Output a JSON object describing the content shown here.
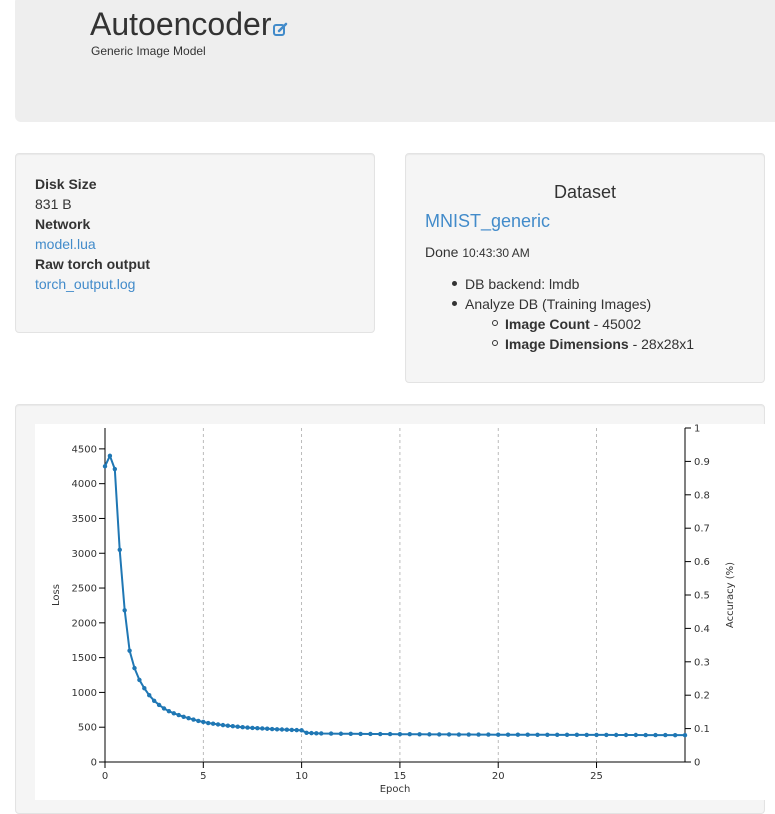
{
  "header": {
    "title": "Autoencoder",
    "subtitle": "Generic Image Model",
    "edit_icon": "edit-icon"
  },
  "info": {
    "disk_size_label": "Disk Size",
    "disk_size_value": "831 B",
    "network_label": "Network",
    "network_link": "model.lua",
    "raw_output_label": "Raw torch output",
    "raw_output_link": "torch_output.log"
  },
  "dataset": {
    "heading": "Dataset",
    "name": "MNIST_generic",
    "status": "Done",
    "status_time": "10:43:30 AM",
    "backend_text": "DB backend: lmdb",
    "analyze_text": "Analyze DB (Training Images)",
    "image_count_label": "Image Count",
    "image_count_value": " - 45002",
    "image_dims_label": "Image Dimensions",
    "image_dims_value": " - 28x28x1"
  },
  "colors": {
    "accent": "#428bca",
    "series": "#1f77b4"
  },
  "chart_data": {
    "type": "line",
    "xlabel": "Epoch",
    "ylabel": "Loss",
    "y2label": "Accuracy (%)",
    "xlim": [
      0,
      29.5
    ],
    "ylim": [
      0,
      4800
    ],
    "y2lim": [
      0,
      1
    ],
    "xticks": [
      0,
      5,
      10,
      15,
      20,
      25
    ],
    "yticks": [
      0,
      500,
      1000,
      1500,
      2000,
      2500,
      3000,
      3500,
      4000,
      4500
    ],
    "y2ticks": [
      0,
      0.1,
      0.2,
      0.3,
      0.4,
      0.5,
      0.6,
      0.7,
      0.8,
      0.9,
      1
    ],
    "grid_x": true,
    "series": [
      {
        "name": "",
        "x": [
          0,
          0.25,
          0.5,
          0.75,
          1,
          1.25,
          1.5,
          1.75,
          2,
          2.25,
          2.5,
          2.75,
          3,
          3.25,
          3.5,
          3.75,
          4,
          4.25,
          4.5,
          4.75,
          5,
          5.25,
          5.5,
          5.75,
          6,
          6.25,
          6.5,
          6.75,
          7,
          7.25,
          7.5,
          7.75,
          8,
          8.25,
          8.5,
          8.75,
          9,
          9.25,
          9.5,
          9.75,
          10,
          10.25,
          10.5,
          10.75,
          11,
          11.5,
          12,
          12.5,
          13,
          13.5,
          14,
          14.5,
          15,
          15.5,
          16,
          16.5,
          17,
          17.5,
          18,
          18.5,
          19,
          19.5,
          20,
          20.5,
          21,
          21.5,
          22,
          22.5,
          23,
          23.5,
          24,
          24.5,
          25,
          25.5,
          26,
          26.5,
          27,
          27.5,
          28,
          28.5,
          29,
          29.5
        ],
        "values": [
          4250,
          4400,
          4210,
          3050,
          2180,
          1600,
          1350,
          1180,
          1060,
          960,
          880,
          820,
          770,
          730,
          700,
          675,
          650,
          630,
          610,
          590,
          575,
          560,
          550,
          540,
          530,
          522,
          515,
          508,
          500,
          495,
          490,
          486,
          482,
          478,
          474,
          470,
          467,
          464,
          461,
          458,
          455,
          420,
          415,
          412,
          410,
          408,
          406,
          405,
          404,
          403,
          402,
          401,
          400,
          399,
          398,
          397,
          396,
          396,
          395,
          395,
          394,
          394,
          393,
          393,
          392,
          392,
          391,
          391,
          390,
          390,
          390,
          389,
          389,
          389,
          388,
          388,
          388,
          387,
          387,
          387,
          386,
          386
        ]
      }
    ]
  }
}
